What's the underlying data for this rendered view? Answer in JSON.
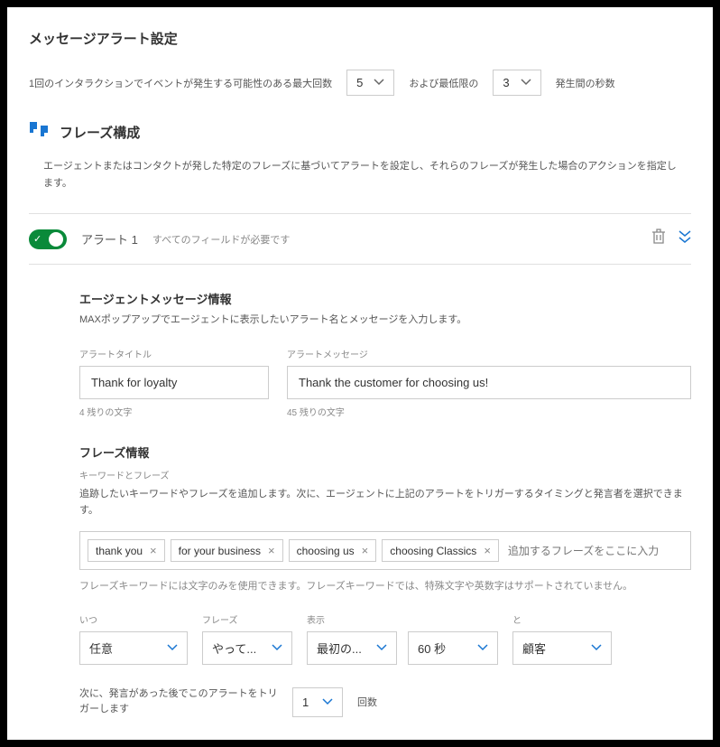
{
  "page": {
    "title": "メッセージアラート設定"
  },
  "topControls": {
    "maxEventsLabel": "1回のインタラクションでイベントが発生する可能性のある最大回数",
    "maxEventsValue": "5",
    "minLabel": "および最低限の",
    "minValue": "3",
    "secondsLabel": "発生間の秒数"
  },
  "phrase": {
    "title": "フレーズ構成",
    "desc": "エージェントまたはコンタクトが発した特定のフレーズに基づいてアラートを設定し、それらのフレーズが発生した場合のアクションを指定します。"
  },
  "alert": {
    "name": "アラート 1",
    "requiredHint": "すべてのフィールドが必要です",
    "agentMessage": {
      "title": "エージェントメッセージ情報",
      "desc": "MAXポップアップでエージェントに表示したいアラート名とメッセージを入力します。",
      "titleLabel": "アラートタイトル",
      "titleValue": "Thank for loyalty",
      "titleRemaining": "4 残りの文字",
      "messageLabel": "アラートメッセージ",
      "messageValue": "Thank the customer for choosing us!",
      "messageRemaining": "45 残りの文字"
    },
    "phraseInfo": {
      "title": "フレーズ情報",
      "keywordsLabel": "キーワードとフレーズ",
      "desc": "追跡したいキーワードやフレーズを追加します。次に、エージェントに上記のアラートをトリガーするタイミングと発言者を選択できます。",
      "chips": [
        "thank you",
        "for your business",
        "choosing us",
        "choosing Classics"
      ],
      "inputPlaceholder": "追加するフレーズをここに入力",
      "hint": "フレーズキーワードには文字のみを使用できます。フレーズキーワードでは、特殊文字や英数字はサポートされていません。",
      "whenLabel": "いつ",
      "whenValue": "任意",
      "phraseLabel": "フレーズ",
      "phraseValue": "やって...",
      "displayLabel": "表示",
      "displayValue": "最初の...",
      "secondsValue": "60 秒",
      "andLabel": "と",
      "andValue": "顧客",
      "triggerLabel": "次に、発言があった後でこのアラートをトリガーします",
      "triggerValue": "1",
      "triggerUnit": "回数"
    }
  }
}
